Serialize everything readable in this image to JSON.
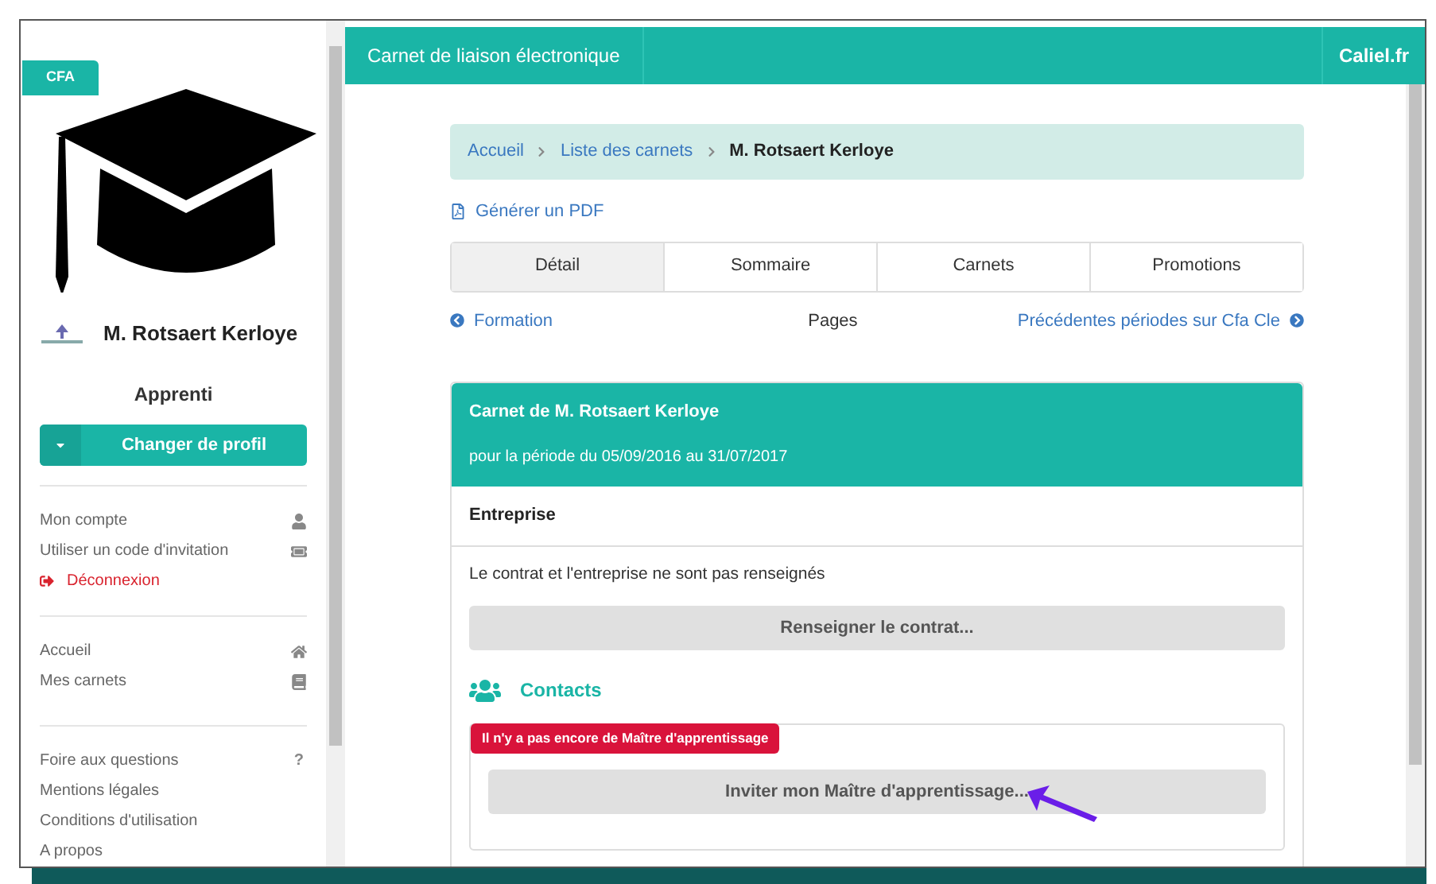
{
  "sidebar": {
    "badge": "CFA",
    "user_name": "M. Rotsaert Kerloye",
    "role": "Apprenti",
    "profile_button": "Changer de profil",
    "menu_groups": [
      [
        {
          "label": "Mon compte",
          "kind": "account"
        },
        {
          "label": "Utiliser un code d'invitation",
          "kind": "invite"
        },
        {
          "label": "Déconnexion",
          "kind": "logout"
        }
      ],
      [
        {
          "label": "Accueil",
          "kind": "home"
        },
        {
          "label": "Mes carnets",
          "kind": "notebooks"
        }
      ],
      [
        {
          "label": "Foire aux questions",
          "icon_text": "?",
          "kind": "plain"
        },
        {
          "label": "Mentions légales",
          "kind": "plain"
        },
        {
          "label": "Conditions d'utilisation",
          "kind": "plain"
        },
        {
          "label": "A propos",
          "kind": "plain"
        }
      ]
    ]
  },
  "header": {
    "title": "Carnet de liaison électronique",
    "brand": "Caliel.fr"
  },
  "breadcrumb": [
    {
      "label": "Accueil",
      "current": false
    },
    {
      "label": "Liste des carnets",
      "current": false
    },
    {
      "label": "M. Rotsaert Kerloye",
      "current": true
    }
  ],
  "pdf_link": "Générer un PDF",
  "tabs": [
    {
      "label": "Détail",
      "selected": true
    },
    {
      "label": "Sommaire",
      "selected": false
    },
    {
      "label": "Carnets",
      "selected": false
    },
    {
      "label": "Promotions",
      "selected": false
    }
  ],
  "pager": {
    "previous": "Formation",
    "center": "Pages",
    "next": "Précédentes périodes sur Cfa Cle"
  },
  "card": {
    "title": "Carnet de M. Rotsaert Kerloye",
    "subtitle": "pour la période du 05/09/2016 au 31/07/2017",
    "section": "Entreprise",
    "notice": "Le contrat et l'entreprise ne sont pas renseignés",
    "contract_button": "Renseigner le contrat...",
    "contacts_title": "Contacts",
    "alert_badge": "Il n'y a pas encore de Maître d'apprentissage",
    "invite_button": "Inviter mon Maître d'apprentissage..."
  }
}
